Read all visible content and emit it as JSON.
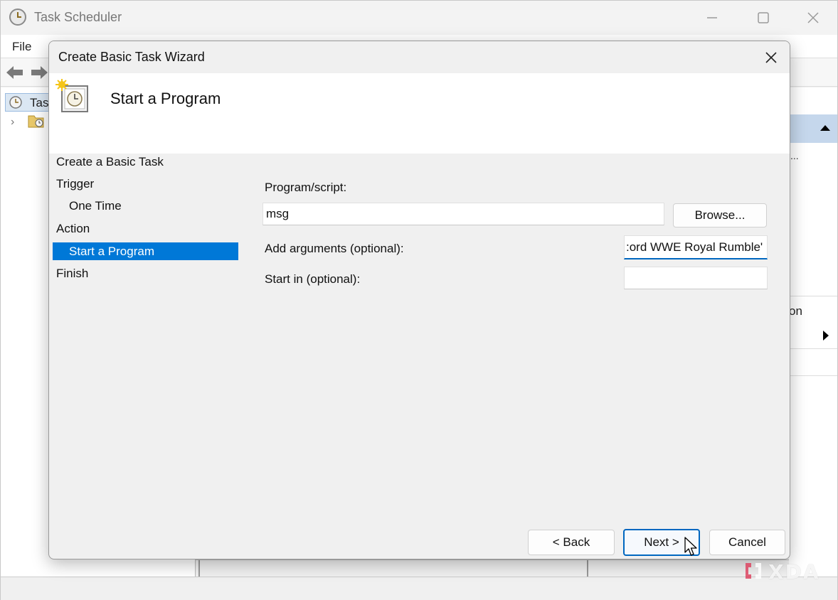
{
  "background_window": {
    "title": "Task Scheduler",
    "menu": {
      "file_label": "File"
    },
    "tree": {
      "root_label": "Task"
    },
    "actions_panel": {
      "partial_text": "on",
      "dots": "..."
    }
  },
  "wizard": {
    "title": "Create Basic Task Wizard",
    "header_title": "Start a Program",
    "steps": [
      {
        "label": "Create a Basic Task",
        "indent": false,
        "active": false
      },
      {
        "label": "Trigger",
        "indent": false,
        "active": false
      },
      {
        "label": "One Time",
        "indent": true,
        "active": false
      },
      {
        "label": "Action",
        "indent": false,
        "active": false
      },
      {
        "label": "Start a Program",
        "indent": true,
        "active": true
      },
      {
        "label": "Finish",
        "indent": false,
        "active": false
      }
    ],
    "form": {
      "program_label": "Program/script:",
      "program_value": "msg",
      "browse_label": "Browse...",
      "arguments_label": "Add arguments (optional):",
      "arguments_value": ":ord WWE Royal Rumble'",
      "start_in_label": "Start in (optional):",
      "start_in_value": ""
    },
    "buttons": {
      "back_label": "< Back",
      "next_label": "Next >",
      "cancel_label": "Cancel"
    }
  },
  "watermark": {
    "text": "XDA"
  },
  "colors": {
    "accent": "#0078d7",
    "focus_border": "#0067c0"
  },
  "icons": [
    "clock-icon",
    "back-arrow-icon",
    "forward-arrow-icon",
    "minimize-icon",
    "maximize-icon",
    "close-icon",
    "scheduled-task-icon",
    "folder-clock-icon",
    "mouse-cursor-icon"
  ]
}
